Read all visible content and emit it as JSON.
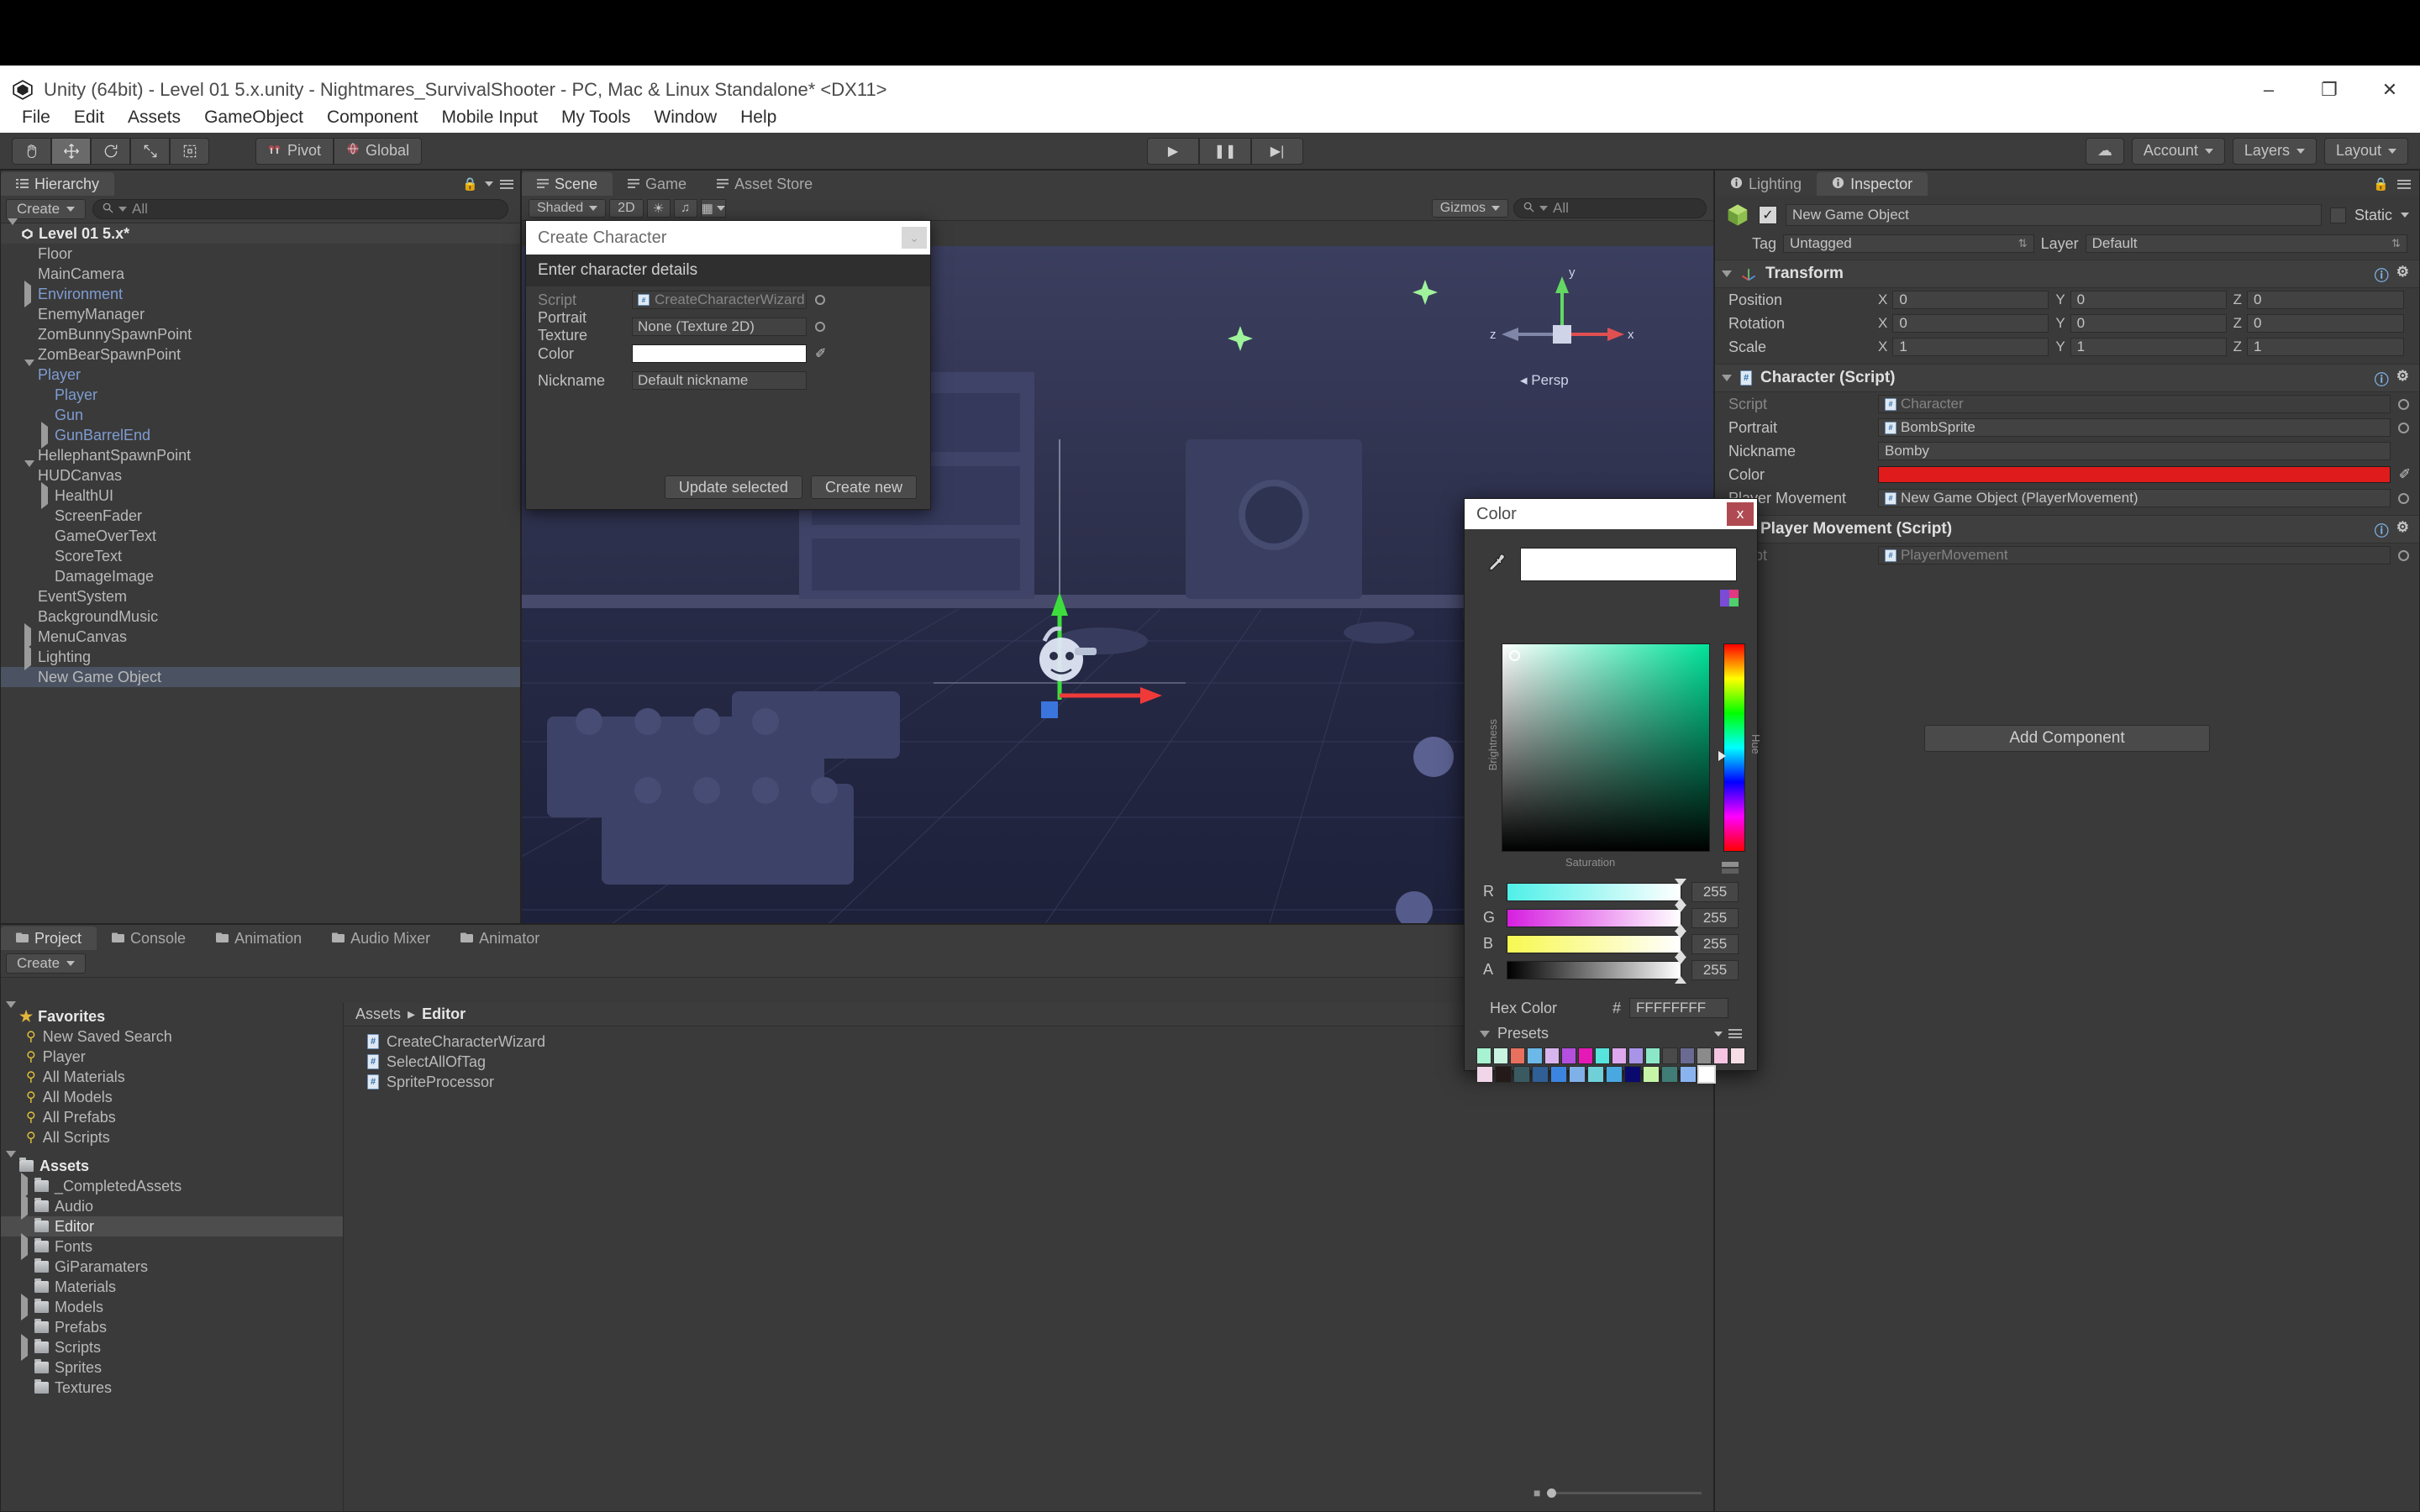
{
  "window": {
    "title": "Unity (64bit) - Level 01 5.x.unity - Nightmares_SurvivalShooter - PC, Mac & Linux Standalone* <DX11>",
    "minimize": "–",
    "maximize": "❐",
    "close": "✕"
  },
  "menubar": [
    "File",
    "Edit",
    "Assets",
    "GameObject",
    "Component",
    "Mobile Input",
    "My Tools",
    "Window",
    "Help"
  ],
  "toolbar": {
    "tools": [
      "hand-tool",
      "move-tool",
      "rotate-tool",
      "scale-tool",
      "rect-tool"
    ],
    "pivot_label": "Pivot",
    "global_label": "Global",
    "play_label": "▶",
    "pause_label": "❚❚",
    "step_label": "▶|",
    "cloud_label": "☁",
    "account_label": "Account",
    "layers_label": "Layers",
    "layout_label": "Layout"
  },
  "hierarchy": {
    "tab": "Hierarchy",
    "create_label": "Create",
    "search_placeholder": "All",
    "items": [
      {
        "label": "Level 01 5.x*",
        "depth": 0,
        "arrow": "down",
        "kind": "scene"
      },
      {
        "label": "Floor",
        "depth": 1,
        "arrow": "none",
        "kind": "plain"
      },
      {
        "label": "MainCamera",
        "depth": 1,
        "arrow": "none",
        "kind": "plain"
      },
      {
        "label": "Environment",
        "depth": 1,
        "arrow": "right",
        "kind": "prefab"
      },
      {
        "label": "EnemyManager",
        "depth": 1,
        "arrow": "none",
        "kind": "plain"
      },
      {
        "label": "ZomBunnySpawnPoint",
        "depth": 1,
        "arrow": "none",
        "kind": "plain"
      },
      {
        "label": "ZomBearSpawnPoint",
        "depth": 1,
        "arrow": "none",
        "kind": "plain"
      },
      {
        "label": "Player",
        "depth": 1,
        "arrow": "down",
        "kind": "prefab"
      },
      {
        "label": "Player",
        "depth": 2,
        "arrow": "none",
        "kind": "prefab"
      },
      {
        "label": "Gun",
        "depth": 2,
        "arrow": "none",
        "kind": "prefab"
      },
      {
        "label": "GunBarrelEnd",
        "depth": 2,
        "arrow": "right",
        "kind": "prefab"
      },
      {
        "label": "HellephantSpawnPoint",
        "depth": 1,
        "arrow": "none",
        "kind": "plain"
      },
      {
        "label": "HUDCanvas",
        "depth": 1,
        "arrow": "down",
        "kind": "plain"
      },
      {
        "label": "HealthUI",
        "depth": 2,
        "arrow": "right",
        "kind": "plain"
      },
      {
        "label": "ScreenFader",
        "depth": 2,
        "arrow": "none",
        "kind": "plain"
      },
      {
        "label": "GameOverText",
        "depth": 2,
        "arrow": "none",
        "kind": "plain"
      },
      {
        "label": "ScoreText",
        "depth": 2,
        "arrow": "none",
        "kind": "plain"
      },
      {
        "label": "DamageImage",
        "depth": 2,
        "arrow": "none",
        "kind": "plain"
      },
      {
        "label": "EventSystem",
        "depth": 1,
        "arrow": "none",
        "kind": "plain"
      },
      {
        "label": "BackgroundMusic",
        "depth": 1,
        "arrow": "none",
        "kind": "plain"
      },
      {
        "label": "MenuCanvas",
        "depth": 1,
        "arrow": "right",
        "kind": "plain"
      },
      {
        "label": "Lighting",
        "depth": 1,
        "arrow": "right",
        "kind": "plain"
      },
      {
        "label": "New Game Object",
        "depth": 1,
        "arrow": "none",
        "kind": "selected"
      }
    ]
  },
  "scene": {
    "tabs": [
      {
        "label": "Scene",
        "icon": "scene-icon",
        "active": true
      },
      {
        "label": "Game",
        "icon": "game-icon",
        "active": false
      },
      {
        "label": "Asset Store",
        "icon": "store-icon",
        "active": false
      }
    ],
    "shading_mode": "Shaded",
    "dimension_mode": "2D",
    "lighting_toggle": "☀",
    "audio_toggle": "♫",
    "effects_toggle": "▦",
    "gizmos_label": "Gizmos",
    "search_placeholder": "All",
    "gizmo_axes": {
      "x": "x",
      "y": "y",
      "z": "z"
    },
    "persp_label": "Persp"
  },
  "wizard": {
    "title": "Create Character",
    "minimize": "⌄",
    "help_text": "Enter character details",
    "fields": [
      {
        "label": "Script",
        "value": "CreateCharacterWizard",
        "type": "object",
        "disabled": true,
        "icon": "cs-script-icon"
      },
      {
        "label": "Portrait Texture",
        "value": "None (Texture 2D)",
        "type": "object",
        "disabled": false,
        "icon": ""
      },
      {
        "label": "Color",
        "value": "#FFFFFF",
        "type": "color",
        "disabled": false,
        "icon": ""
      },
      {
        "label": "Nickname",
        "value": "Default nickname",
        "type": "text",
        "disabled": false,
        "icon": ""
      }
    ],
    "buttons": [
      {
        "label": "Update selected"
      },
      {
        "label": "Create new"
      }
    ]
  },
  "inspector": {
    "tabs": [
      {
        "label": "Inspector",
        "icon": "info-icon",
        "active": true
      },
      {
        "label": "Lighting",
        "icon": "lighting-icon",
        "active": false
      }
    ],
    "object_name": "New Game Object",
    "enabled": true,
    "static_label": "Static",
    "tag_label": "Tag",
    "tag_value": "Untagged",
    "layer_label": "Layer",
    "layer_value": "Default",
    "transform": {
      "header": "Transform",
      "rows": [
        {
          "label": "Position",
          "x": "0",
          "y": "0",
          "z": "0"
        },
        {
          "label": "Rotation",
          "x": "0",
          "y": "0",
          "z": "0"
        },
        {
          "label": "Scale",
          "x": "1",
          "y": "1",
          "z": "1"
        }
      ],
      "axis_labels": [
        "X",
        "Y",
        "Z"
      ]
    },
    "character_script": {
      "header": "Character (Script)",
      "rows": [
        {
          "label": "Script",
          "value": "Character",
          "type": "object",
          "disabled": true
        },
        {
          "label": "Portrait",
          "value": "BombSprite",
          "type": "object",
          "disabled": false
        },
        {
          "label": "Nickname",
          "value": "Bomby",
          "type": "text",
          "disabled": false
        },
        {
          "label": "Color",
          "value": "#E01B1B",
          "type": "color",
          "disabled": false
        },
        {
          "label": "Player Movement",
          "value": "New Game Object (PlayerMovement)",
          "type": "object",
          "disabled": false
        }
      ]
    },
    "player_movement_script": {
      "header": "Player Movement (Script)",
      "rows": [
        {
          "label": "Script",
          "value": "PlayerMovement",
          "type": "object",
          "disabled": true
        }
      ]
    },
    "add_component_label": "Add Component"
  },
  "colorpicker": {
    "title": "Color",
    "close_label": "x",
    "eyedropper_icon": "eyedropper-icon",
    "preview_color": "#FFFFFF",
    "swatch_picker_icon": "color-swatch-icon",
    "sv_square": {
      "base_hue": "#00e39a",
      "brightness_label": "Brightness",
      "saturation_label": "Saturation"
    },
    "hue_label": "Hue",
    "channels": [
      {
        "label": "R",
        "value": "255",
        "gradient_from": "#4ff0e8",
        "gradient_to": "#ffffff"
      },
      {
        "label": "G",
        "value": "255",
        "gradient_from": "#d61fe0",
        "gradient_to": "#ffffff"
      },
      {
        "label": "B",
        "value": "255",
        "gradient_from": "#f8f850",
        "gradient_to": "#ffffff"
      },
      {
        "label": "A",
        "value": "255",
        "gradient_from": "#000000",
        "gradient_to": "#ffffff"
      }
    ],
    "hex_label": "Hex Color",
    "hex_hash": "#",
    "hex_value": "FFFFFFFF",
    "presets_label": "Presets",
    "preset_rows": [
      [
        "#a7f2d0",
        "#c9f4e2",
        "#e8705e",
        "#6cb8e8",
        "#d8b5ee",
        "#b44fe0",
        "#e519b6",
        "#56e4dc",
        "#dfa8ee",
        "#a995e8",
        "#8ae8c8",
        "#4a4a4a",
        "#6a6a92",
        "#8b8b8b",
        "#f5c4e2",
        "#f6dde6"
      ],
      [
        "#f0d6e8",
        "#241a1a",
        "#3a5a62",
        "#2f5f94",
        "#3b85e0",
        "#7fb0e8",
        "#6fd0d8",
        "#4aa8e0",
        "#0a0a6e",
        "#c6f5a8",
        "#3f7d76",
        "#8ab4ef",
        "#ffffff"
      ]
    ],
    "selected_preset_index": 12
  },
  "project": {
    "tabs": [
      {
        "label": "Project",
        "icon": "folder-icon",
        "active": true
      },
      {
        "label": "Console",
        "icon": "console-icon",
        "active": false
      },
      {
        "label": "Animation",
        "icon": "clock-icon",
        "active": false
      },
      {
        "label": "Audio Mixer",
        "icon": "mixer-icon",
        "active": false
      },
      {
        "label": "Animator",
        "icon": "animator-icon",
        "active": false
      }
    ],
    "create_label": "Create",
    "favorites": {
      "label": "Favorites",
      "items": [
        "New Saved Search",
        "Player",
        "All Materials",
        "All Models",
        "All Prefabs",
        "All Scripts"
      ]
    },
    "assets": {
      "label": "Assets",
      "items": [
        {
          "label": "_CompletedAssets",
          "arrow": "right",
          "selected": false
        },
        {
          "label": "Audio",
          "arrow": "right",
          "selected": false
        },
        {
          "label": "Editor",
          "arrow": "none",
          "selected": true
        },
        {
          "label": "Fonts",
          "arrow": "right",
          "selected": false
        },
        {
          "label": "GiParamaters",
          "arrow": "none",
          "selected": false
        },
        {
          "label": "Materials",
          "arrow": "none",
          "selected": false
        },
        {
          "label": "Models",
          "arrow": "right",
          "selected": false
        },
        {
          "label": "Prefabs",
          "arrow": "none",
          "selected": false
        },
        {
          "label": "Scripts",
          "arrow": "right",
          "selected": false
        },
        {
          "label": "Sprites",
          "arrow": "none",
          "selected": false
        },
        {
          "label": "Textures",
          "arrow": "none",
          "selected": false
        }
      ]
    },
    "breadcrumb": [
      "Assets",
      "Editor"
    ],
    "asset_files": [
      "CreateCharacterWizard",
      "SelectAllOfTag",
      "SpriteProcessor"
    ]
  }
}
